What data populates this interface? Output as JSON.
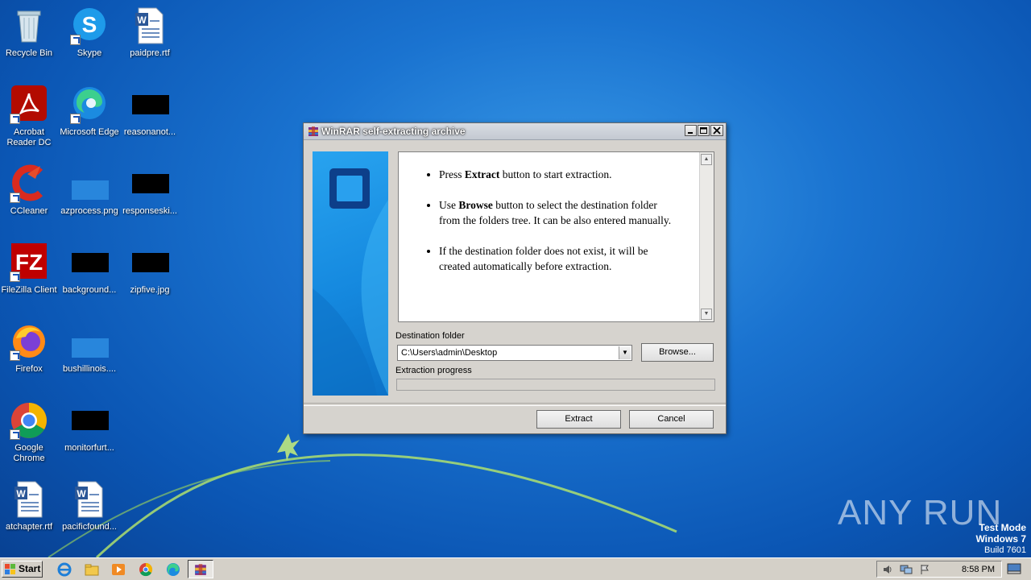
{
  "desktop": {
    "icons": [
      {
        "label": "Recycle Bin"
      },
      {
        "label": "Skype"
      },
      {
        "label": "paidpre.rtf"
      },
      {
        "label": "Acrobat Reader DC"
      },
      {
        "label": "Microsoft Edge"
      },
      {
        "label": "reasonanot..."
      },
      {
        "label": "CCleaner"
      },
      {
        "label": "azprocess.png"
      },
      {
        "label": "responseski..."
      },
      {
        "label": "FileZilla Client"
      },
      {
        "label": "background..."
      },
      {
        "label": "zipfive.jpg"
      },
      {
        "label": "Firefox"
      },
      {
        "label": "bushillinois...."
      },
      {
        "label": "Google Chrome"
      },
      {
        "label": "monitorfurt..."
      },
      {
        "label": "atchapter.rtf"
      },
      {
        "label": "pacificfound..."
      }
    ]
  },
  "dialog": {
    "title": "WinRAR self-extracting archive",
    "instructions": [
      {
        "pre": "Press ",
        "bold": "Extract",
        "post": " button to start extraction."
      },
      {
        "pre": "Use ",
        "bold": "Browse",
        "post": " button to select the destination folder from the folders tree. It can be also entered manually."
      },
      {
        "pre": "",
        "bold": "",
        "post": "If the destination folder does not exist, it will be created automatically before extraction."
      }
    ],
    "destination_label": "Destination folder",
    "destination_value": "C:\\Users\\admin\\Desktop",
    "browse_label": "Browse...",
    "progress_label": "Extraction progress",
    "progress_value": 0,
    "extract_label": "Extract",
    "cancel_label": "Cancel"
  },
  "watermark": {
    "text": "ANY RUN",
    "test_mode": "Test Mode",
    "os": "Windows 7",
    "build": "Build 7601"
  },
  "taskbar": {
    "start_label": "Start",
    "clock": "8:58 PM"
  }
}
